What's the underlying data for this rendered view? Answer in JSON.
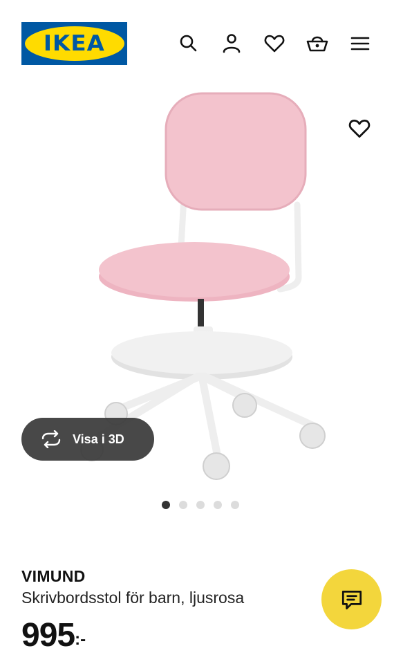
{
  "brand": {
    "logo_text": "IKEA",
    "colors": {
      "blue": "#0058a3",
      "yellow": "#ffdb00"
    }
  },
  "header": {
    "icons": [
      "search-icon",
      "account-icon",
      "wishlist-heart-icon",
      "shopping-basket-icon",
      "menu-icon"
    ]
  },
  "gallery": {
    "favorite_icon": "heart-outline-icon",
    "view_3d_label": "Visa i 3D",
    "view_3d_icon": "rotate-arrows-icon",
    "image_count": 5,
    "active_index": 1
  },
  "product": {
    "name": "VIMUND",
    "description": "Skrivbordsstol för barn, ljusrosa",
    "price": "995",
    "price_suffix": ":-"
  },
  "chat": {
    "icon": "chat-bubble-icon",
    "color": "#f3d63c"
  }
}
